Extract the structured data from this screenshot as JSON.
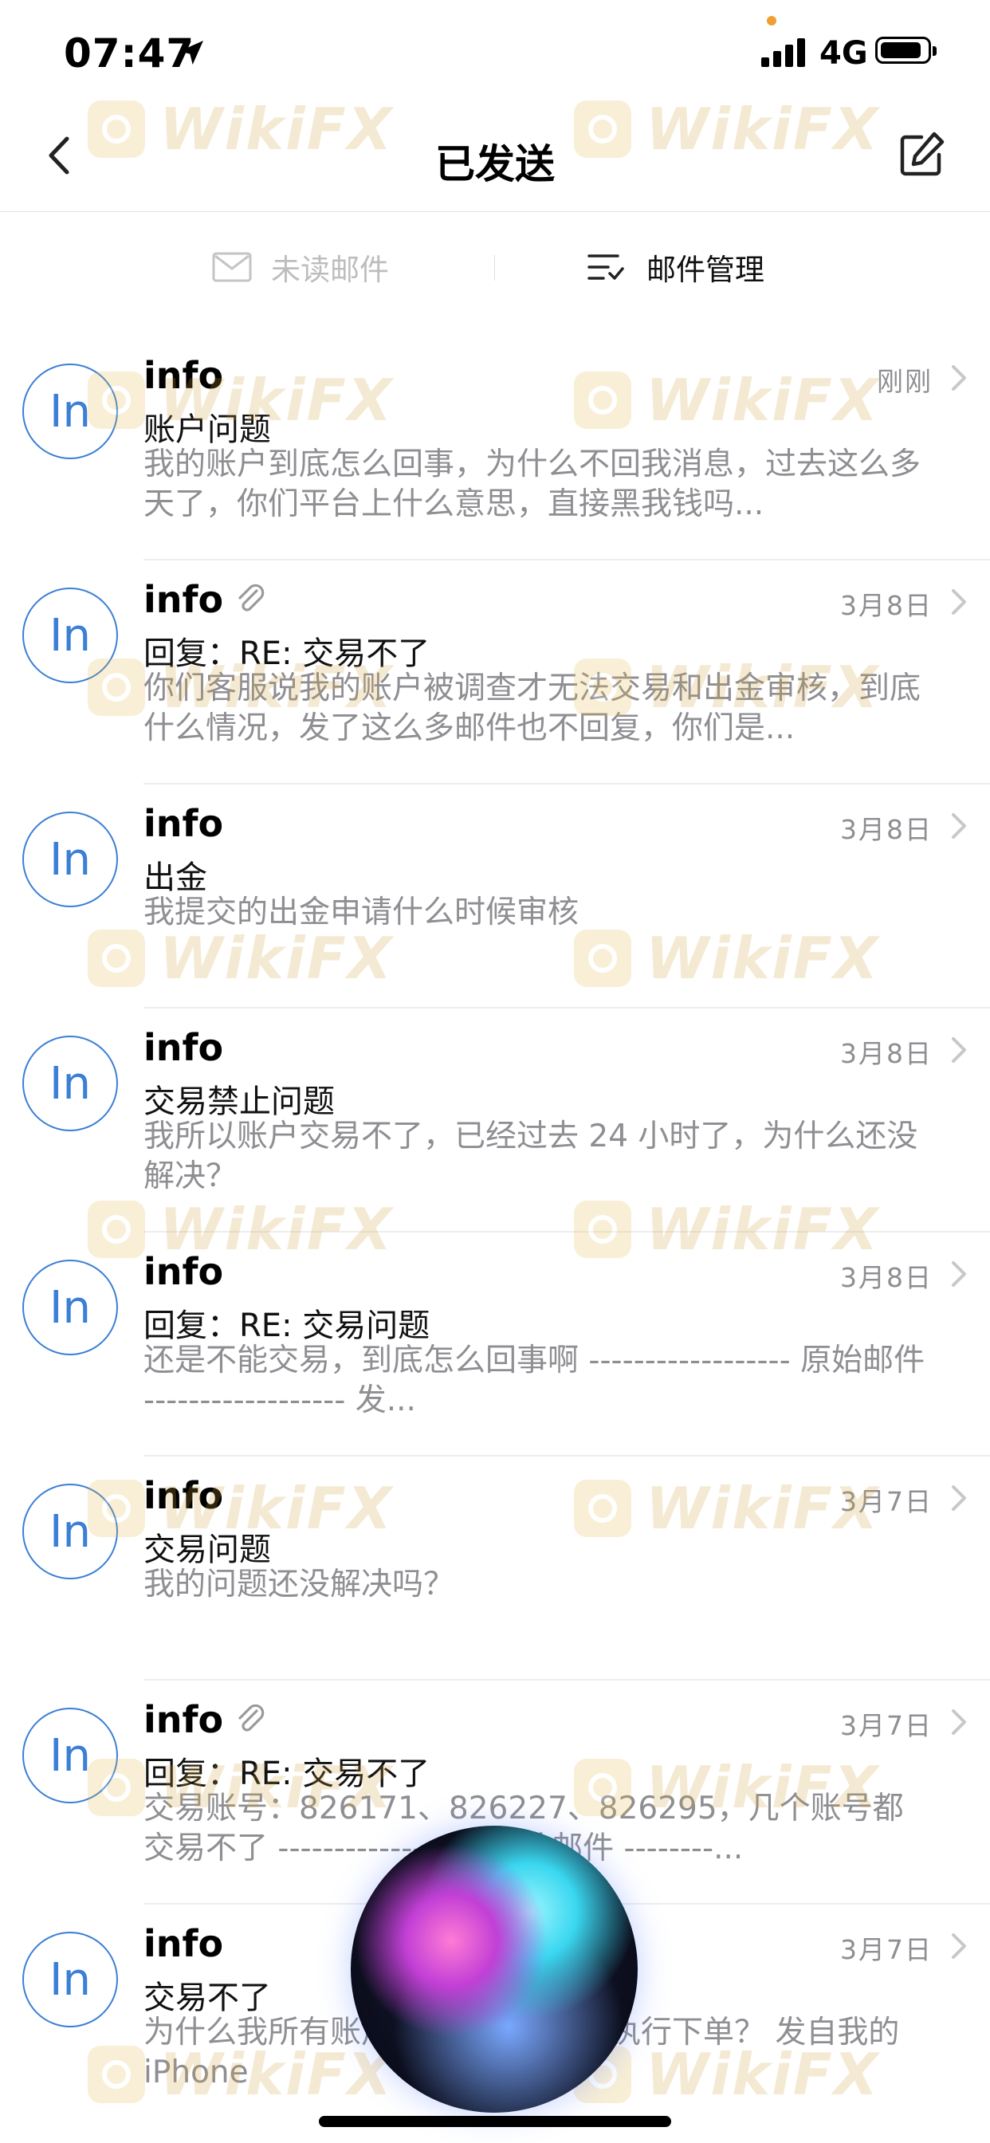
{
  "status_bar": {
    "time": "07:47",
    "network": "4G",
    "battery_level": 0.9
  },
  "nav": {
    "title": "已发送"
  },
  "toolbar": {
    "unread_label": "未读邮件",
    "manage_label": "邮件管理"
  },
  "watermark": {
    "text": "WikiFX"
  },
  "emails": [
    {
      "avatar": "In",
      "sender": "info",
      "attachment": false,
      "date": "刚刚",
      "subject": "账户问题",
      "preview": "我的账户到底怎么回事，为什么不回我消息，过去这么多天了，你们平台上什么意思，直接黑我钱吗..."
    },
    {
      "avatar": "In",
      "sender": "info",
      "attachment": true,
      "date": "3月8日",
      "subject": "回复：RE: 交易不了",
      "preview": "你们客服说我的账户被调查才无法交易和出金审核，到底什么情况，发了这么多邮件也不回复，你们是..."
    },
    {
      "avatar": "In",
      "sender": "info",
      "attachment": false,
      "date": "3月8日",
      "subject": "出金",
      "preview": "我提交的出金申请什么时候审核"
    },
    {
      "avatar": "In",
      "sender": "info",
      "attachment": false,
      "date": "3月8日",
      "subject": "交易禁止问题",
      "preview": "我所以账户交易不了，已经过去 24 小时了，为什么还没解决？"
    },
    {
      "avatar": "In",
      "sender": "info",
      "attachment": false,
      "date": "3月8日",
      "subject": "回复：RE: 交易问题",
      "preview": "还是不能交易，到底怎么回事啊 ------------------ 原始邮件 ------------------ 发..."
    },
    {
      "avatar": "In",
      "sender": "info",
      "attachment": false,
      "date": "3月7日",
      "subject": "交易问题",
      "preview": "我的问题还没解决吗？"
    },
    {
      "avatar": "In",
      "sender": "info",
      "attachment": true,
      "date": "3月7日",
      "subject": "回复：RE: 交易不了",
      "preview": "交易账号：826171、826227、826295，几个账号都交易不了 ------------------ 原始邮件 --------..."
    },
    {
      "avatar": "In",
      "sender": "info",
      "attachment": false,
      "date": "3月7日",
      "subject": "交易不了",
      "preview": "为什么我所有账户都不能交易，不执行下单？ 发自我的 iPhone"
    }
  ]
}
